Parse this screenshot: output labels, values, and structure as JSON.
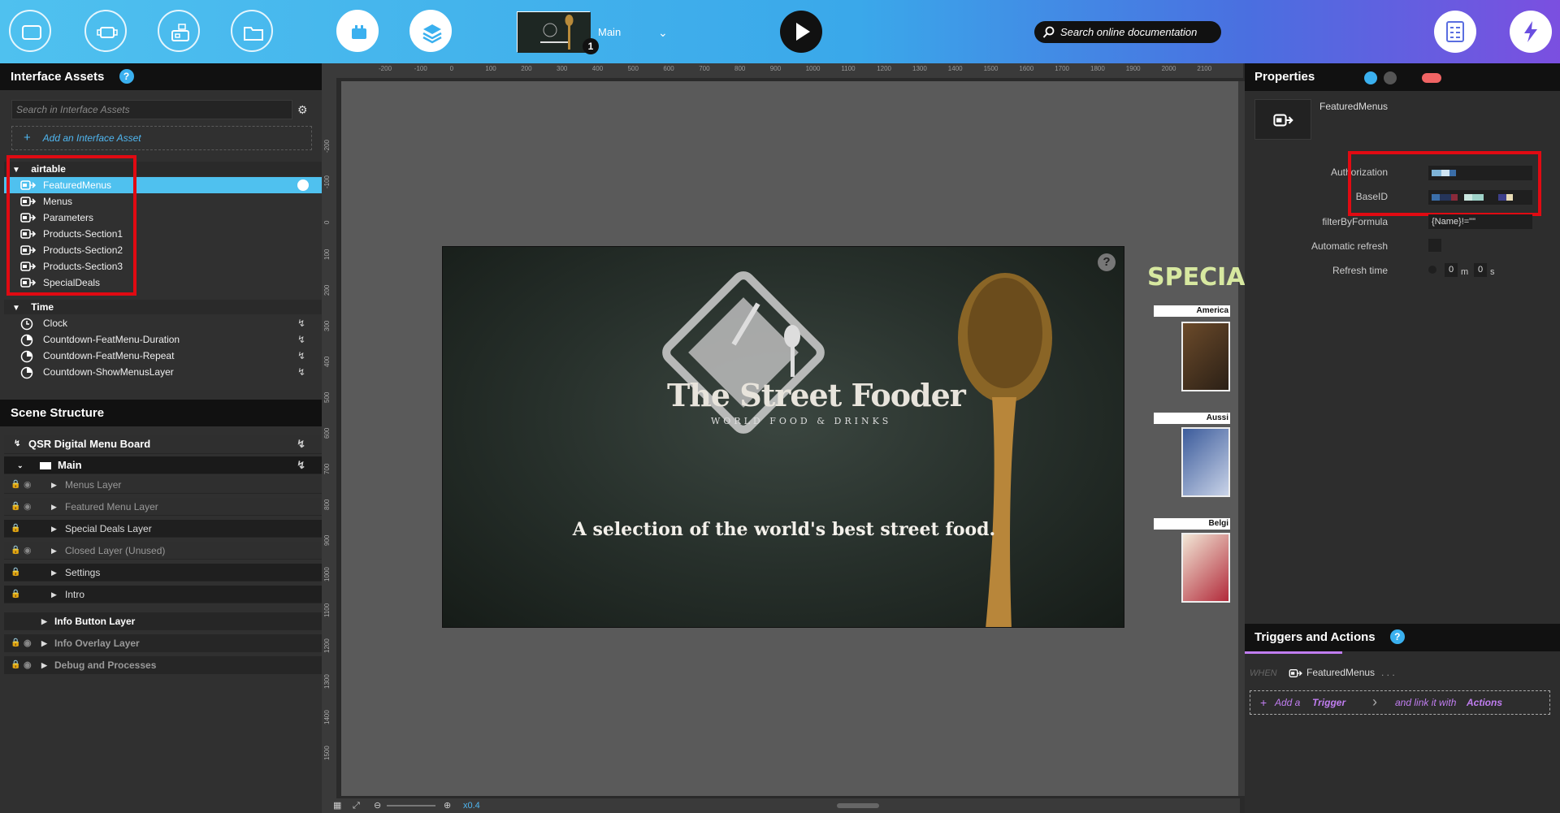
{
  "toolbar": {
    "scene_name": "Main",
    "scene_badge": "1",
    "search_placeholder": "Search online documentation"
  },
  "assets_panel": {
    "title": "Interface Assets",
    "help": "?",
    "search_placeholder": "Search in Interface Assets",
    "add_label": "Add an Interface Asset",
    "groups": [
      {
        "name": "airtable",
        "items": [
          "FeaturedMenus",
          "Menus",
          "Parameters",
          "Products-Section1",
          "Products-Section2",
          "Products-Section3",
          "SpecialDeals"
        ]
      },
      {
        "name": "Time",
        "items": [
          "Clock",
          "Countdown-FeatMenu-Duration",
          "Countdown-FeatMenu-Repeat",
          "Countdown-ShowMenusLayer"
        ]
      }
    ]
  },
  "scene_panel": {
    "title": "Scene Structure",
    "project": "QSR Digital Menu Board",
    "scene": "Main",
    "layers": [
      "Menus Layer",
      "Featured Menu Layer",
      "Special Deals Layer",
      "Closed Layer (Unused)",
      "Settings",
      "Intro"
    ],
    "root_layers": [
      "Info Button Layer",
      "Info Overlay Layer",
      "Debug and Processes"
    ]
  },
  "canvas": {
    "ruler_top": [
      "-200",
      "-100",
      "0",
      "100",
      "200",
      "300",
      "400",
      "500",
      "600",
      "700",
      "800",
      "900",
      "1000",
      "1100",
      "1200",
      "1300",
      "1400",
      "1500",
      "1600",
      "1700",
      "1800",
      "1900",
      "2000",
      "2100"
    ],
    "ruler_left": [
      "-200",
      "-100",
      "0",
      "100",
      "200",
      "300",
      "400",
      "500",
      "600",
      "700",
      "800",
      "900",
      "1000",
      "1100",
      "1200",
      "1300",
      "1400",
      "1500"
    ],
    "zoom": "x0.4",
    "stage_title": "The Street Fooder",
    "stage_subtitle": "WORLD FOOD & DRINKS",
    "stage_tagline": "A selection of the world's best street food.",
    "stage_help": "?",
    "specials_title": "SPECIA",
    "specials_banners": [
      "America",
      "Aussi",
      "Belgi"
    ]
  },
  "properties_panel": {
    "title": "Properties",
    "asset_name": "FeaturedMenus",
    "fields": {
      "authorization": "Authorization",
      "baseid": "BaseID",
      "filter_label": "filterByFormula",
      "filter_value": "{Name}!=\"\"",
      "auto_refresh": "Automatic refresh",
      "refresh_time": "Refresh time",
      "refresh_minutes": "0",
      "refresh_minutes_unit": "m",
      "refresh_seconds": "0",
      "refresh_seconds_unit": "s"
    }
  },
  "triggers_panel": {
    "title": "Triggers and Actions",
    "help": "?",
    "when": "WHEN",
    "asset": "FeaturedMenus",
    "ellipsis": ". . .",
    "add_prefix": "Add a",
    "add_trigger": "Trigger",
    "link_prefix": "and link it with",
    "link_actions": "Actions"
  },
  "colors": {
    "accent": "#4fc1ef",
    "highlight_box": "#e10a12",
    "trigger_purple": "#c07df0"
  }
}
